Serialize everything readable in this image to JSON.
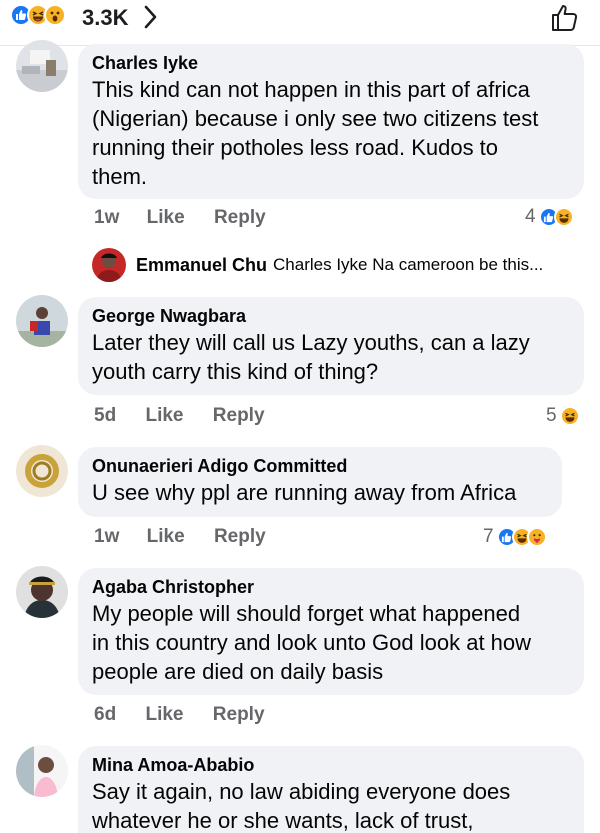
{
  "header": {
    "reaction_count": "3.3K",
    "reactions": [
      "like-icon",
      "haha-icon",
      "wow-icon"
    ]
  },
  "comments": [
    {
      "author": "Charles Iyke",
      "lines": [
        "This kind can not happen in this part of africa",
        "(Nigerian) because i only see two citizens test",
        "running their potholes less road.  Kudos to",
        "them."
      ],
      "time": "1w",
      "like": "Like",
      "reply": "Reply",
      "reaction_count": "4",
      "reactions": [
        "like-icon",
        "haha-icon"
      ]
    },
    {
      "author": "George Nwagbara",
      "lines": [
        "Later they will call us Lazy youths, can a lazy",
        "youth carry this kind of thing?"
      ],
      "time": "5d",
      "like": "Like",
      "reply": "Reply",
      "reaction_count": "5",
      "reactions": [
        "haha-icon"
      ]
    },
    {
      "author": "Onunaerieri Adigo Committed",
      "lines": [
        "U see why ppl are running away from Africa"
      ],
      "time": "1w",
      "like": "Like",
      "reply": "Reply",
      "reaction_count": "7",
      "reactions": [
        "like-icon",
        "haha-icon",
        "care-icon"
      ]
    },
    {
      "author": "Agaba Christopher",
      "lines": [
        "My people will should forget what happened",
        "in this country and look unto God look at how",
        "people are died on daily basis"
      ],
      "time": "6d",
      "like": "Like",
      "reply": "Reply"
    },
    {
      "author": "Mina Amoa-Ababio",
      "lines": [
        "Say it again, no law abiding everyone does",
        "whatever he or she wants, lack of trust,"
      ]
    }
  ],
  "reply_preview": {
    "author": "Emmanuel Chu",
    "text": "Charles Iyke Na cameroon be this..."
  },
  "colors": {
    "bubble": "#f0f2f5",
    "meta": "#65676b",
    "like_blue": "#1877f2",
    "emoji_yellow": "#f7b125"
  }
}
